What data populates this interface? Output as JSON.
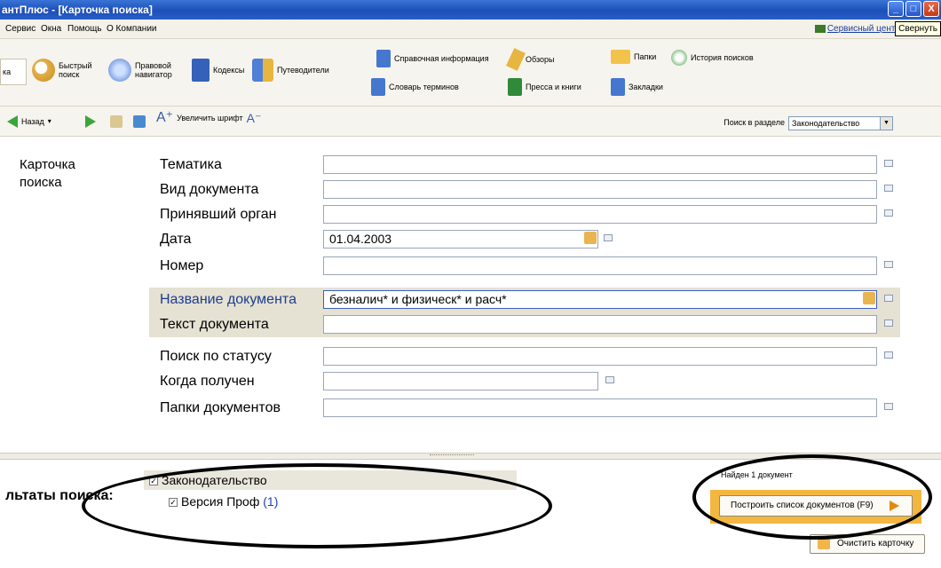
{
  "window": {
    "title": "антПлюс - [Карточка поиска]",
    "buttons": [
      "_",
      "□",
      "X"
    ]
  },
  "menubar": {
    "items": [
      "Сервис",
      "Окна",
      "Помощь",
      "О Компании"
    ],
    "service_center": "Сервисный центр",
    "tooltip": "Свернуть"
  },
  "toolbar": {
    "card_tab": "ка",
    "quick_search": "Быстрый поиск",
    "legal_navigator": "Правовой навигатор",
    "codes": "Кодексы",
    "guides": "Путеводители",
    "reference_info": "Справочная информация",
    "reviews": "Обзоры",
    "folders": "Папки",
    "search_history": "История поисков",
    "glossary": "Словарь терминов",
    "press_books": "Пресса и книги",
    "bookmarks": "Закладки"
  },
  "navbar": {
    "back": "Назад",
    "increase_font": "Увеличить шрифт",
    "search_in_section_label": "Поиск в разделе",
    "search_in_section_value": "Законодательство"
  },
  "card": {
    "title": "Карточка поиска",
    "fields": [
      {
        "label": "Тематика",
        "value": ""
      },
      {
        "label": "Вид документа",
        "value": ""
      },
      {
        "label": "Принявший орган",
        "value": ""
      },
      {
        "label": "Дата",
        "value": "01.04.2003"
      },
      {
        "label": "Номер",
        "value": ""
      },
      {
        "label": "Название документа",
        "value": "безналич* и физическ* и расч*"
      },
      {
        "label": "Текст документа",
        "value": ""
      },
      {
        "label": "Поиск по статусу",
        "value": ""
      },
      {
        "label": "Когда получен",
        "value": ""
      },
      {
        "label": "Папки документов",
        "value": ""
      }
    ]
  },
  "results": {
    "label": "льтаты поиска:",
    "tree": [
      {
        "label": "Законодательство",
        "checked": true
      },
      {
        "label": "Версия Проф",
        "count": "(1)",
        "checked": true
      }
    ],
    "found_text": "Найден 1 документ",
    "build_list_button": "Построить список документов (F9)",
    "clear_card_button": "Очистить карточку"
  },
  "colors": {
    "title_bar": "#1c4fb8",
    "highlight_row": "#e5e1d3",
    "active_label": "#1c3d8f",
    "build_box": "#f3b73f"
  }
}
